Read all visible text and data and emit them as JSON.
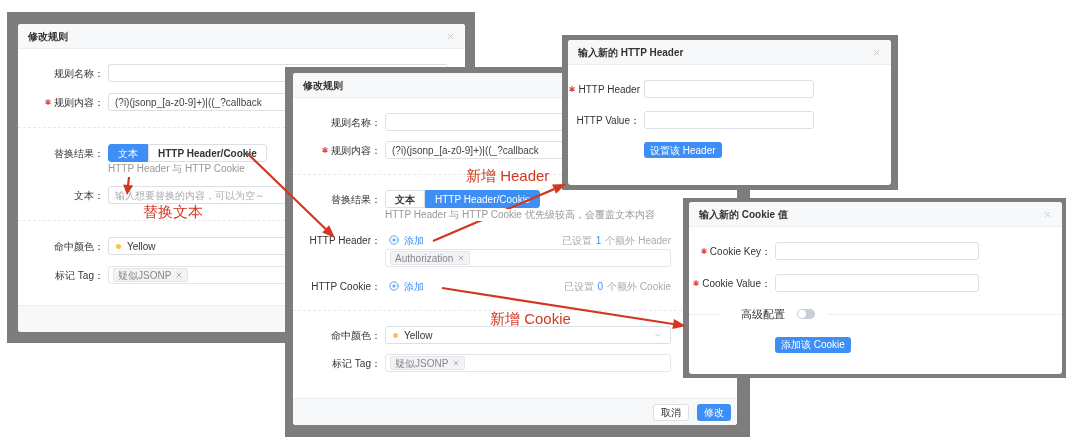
{
  "screenshots": [
    {
      "title": "修改规则",
      "fields": [
        {
          "kind": "input",
          "label": "规则名称：",
          "required": false
        },
        {
          "kind": "input",
          "label": "规则内容：",
          "required": true,
          "value": "(?i)(jsonp_[a-z0-9]+)|((_?callback"
        },
        {
          "kind": "divider"
        },
        {
          "kind": "segmented",
          "label": "替换结果：",
          "options": [
            {
              "label": "文本",
              "selected": true
            },
            {
              "label": "HTTP Header/Cookie",
              "selected": false
            }
          ],
          "hint": "HTTP Header 与 HTTP Cookie"
        },
        {
          "kind": "input",
          "label": "文本：",
          "placeholder": "输入想要替换的内容，可以为空～"
        },
        {
          "kind": "divider"
        },
        {
          "kind": "color",
          "label": "命中颜色：",
          "value": "Yellow",
          "color": "#f8c544"
        },
        {
          "kind": "tags",
          "label": "标记 Tag：",
          "tags": [
            "疑似JSONP"
          ]
        }
      ]
    },
    {
      "title": "修改规则",
      "fields": [
        {
          "kind": "input",
          "label": "规则名称：",
          "required": false
        },
        {
          "kind": "input",
          "label": "规则内容：",
          "required": true,
          "value": "(?i)(jsonp_[a-z0-9]+)|((_?callback"
        },
        {
          "kind": "divider"
        },
        {
          "kind": "segmented",
          "label": "替换结果：",
          "options": [
            {
              "label": "文本",
              "selected": false
            },
            {
              "label": "HTTP Header/Cookie",
              "selected": true
            }
          ],
          "hint": "HTTP Header 与 HTTP Cookie 优先级较高，会覆盖文本内容"
        },
        {
          "kind": "list",
          "label": "HTTP Header：",
          "add": "添加",
          "count_prefix": "已设置",
          "count": "1",
          "count_suffix": "个额外 Header",
          "tags": [
            "Authorization"
          ]
        },
        {
          "kind": "list",
          "label": "HTTP Cookie：",
          "add": "添加",
          "count_prefix": "已设置",
          "count": "0",
          "count_suffix": "个额外 Cookie"
        },
        {
          "kind": "divider"
        },
        {
          "kind": "color",
          "label": "命中颜色：",
          "value": "Yellow",
          "color": "#f8c544"
        },
        {
          "kind": "tags",
          "label": "标记 Tag：",
          "tags": [
            "疑似JSONP"
          ]
        }
      ],
      "footer": [
        {
          "label": "取消",
          "kind": "default"
        },
        {
          "label": "修改",
          "kind": "primary"
        }
      ]
    },
    {
      "title": "输入新的 HTTP Header",
      "fields": [
        {
          "kind": "input",
          "label": "HTTP Header",
          "required": true
        },
        {
          "kind": "input",
          "label": "HTTP Value：",
          "required": false
        },
        {
          "kind": "button",
          "label": "设置该 Header"
        }
      ]
    },
    {
      "title": "输入新的 Cookie 值",
      "fields": [
        {
          "kind": "input",
          "label": "Cookie Key：",
          "required": true
        },
        {
          "kind": "input",
          "label": "Cookie Value：",
          "required": true
        },
        {
          "kind": "switch",
          "label": "高级配置",
          "on": false
        },
        {
          "kind": "button",
          "label": "添加该 Cookie"
        }
      ]
    }
  ],
  "annotations": [
    {
      "text": "替换文本"
    },
    {
      "text": "新增 Header"
    },
    {
      "text": "新增 Cookie"
    }
  ]
}
